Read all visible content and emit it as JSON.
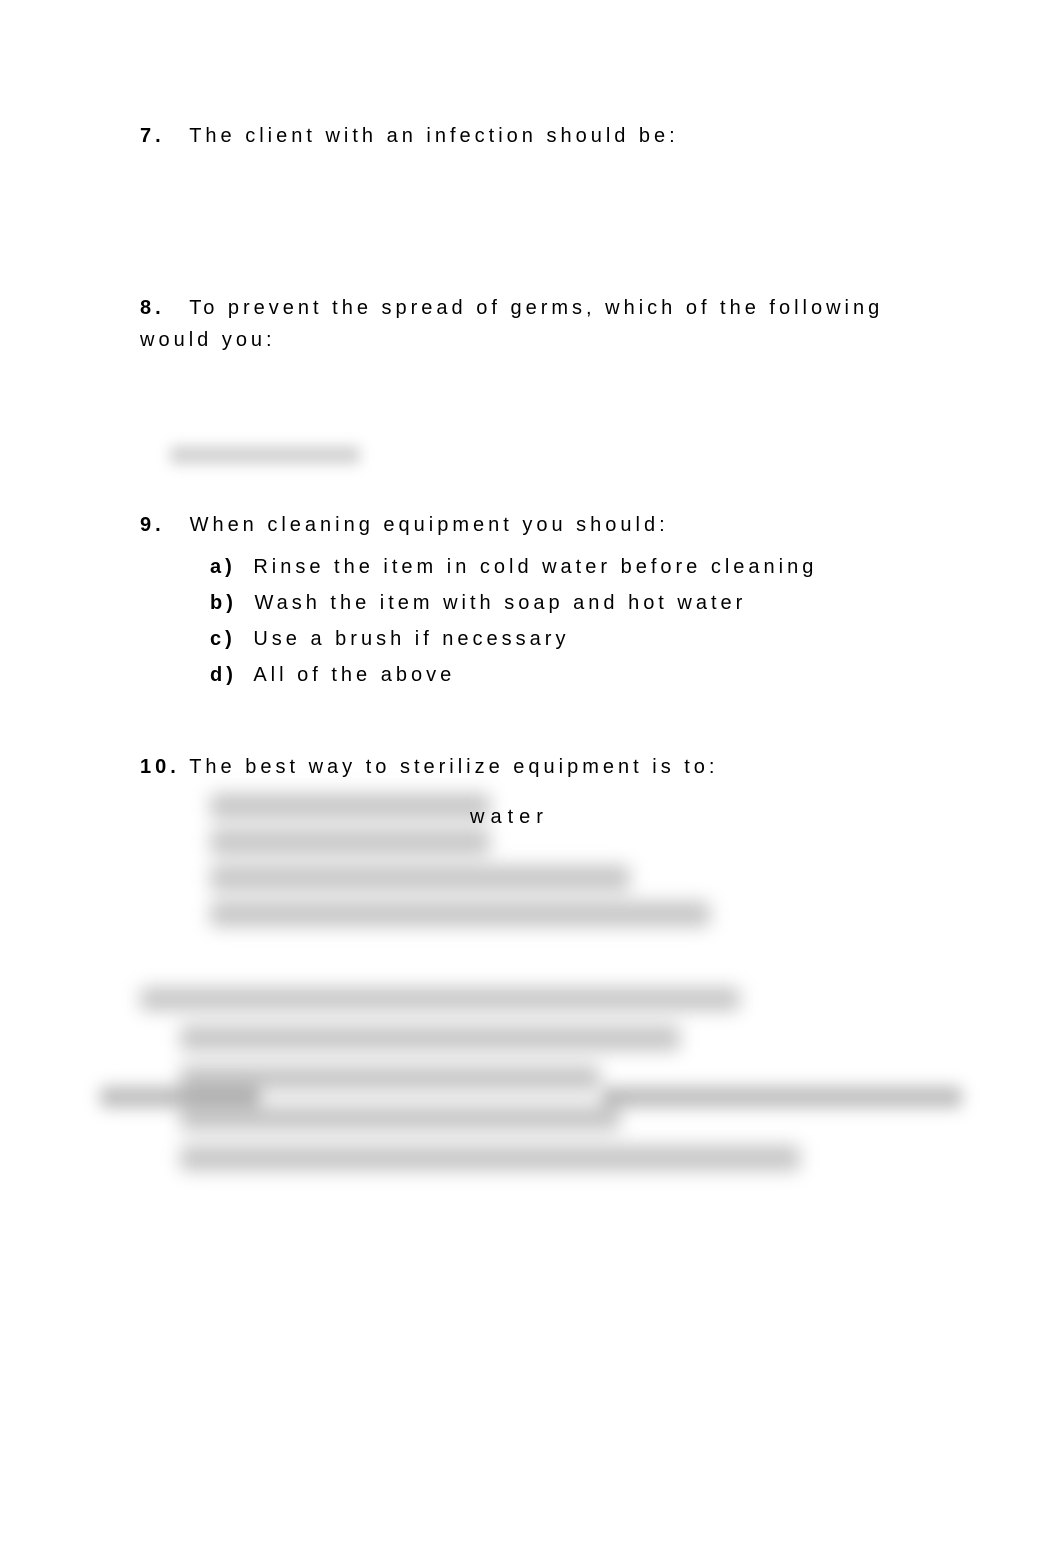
{
  "questions": {
    "q7": {
      "number": "7.",
      "text": "The client with an infection should be:"
    },
    "q8": {
      "number": "8.",
      "text": "To prevent the spread of germs, which of the following would you:"
    },
    "q9": {
      "number": "9.",
      "text": "When cleaning equipment you should:",
      "options": {
        "a": {
          "letter": "a)",
          "text": "Rinse the item in cold water before cleaning"
        },
        "b": {
          "letter": "b)",
          "text": "Wash the item with soap and hot water"
        },
        "c": {
          "letter": "c)",
          "text": "Use a brush if necessary"
        },
        "d": {
          "letter": "d)",
          "text": "All of the above"
        }
      }
    },
    "q10": {
      "number": "10.",
      "text": "The best way to sterilize equipment is to:",
      "visible_word": "water"
    }
  }
}
